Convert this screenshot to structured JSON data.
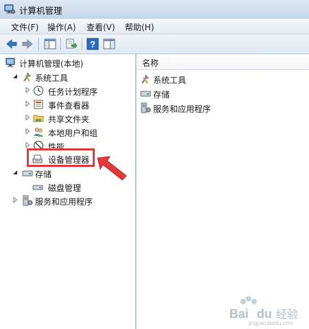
{
  "window": {
    "title": "计算机管理"
  },
  "menu": [
    "文件(F)",
    "操作(A)",
    "查看(V)",
    "帮助(H)"
  ],
  "toolbar": {
    "buttons": [
      "back-icon",
      "forward-icon",
      "show-hide-console-tree-icon",
      "export-list-icon",
      "help-icon",
      "show-hide-action-pane-icon"
    ]
  },
  "tree": {
    "root": "计算机管理(本地)",
    "system_tools": "系统工具",
    "task_scheduler": "任务计划程序",
    "event_viewer": "事件查看器",
    "shared_folders": "共享文件夹",
    "local_users": "本地用户和组",
    "performance": "性能",
    "device_manager": "设备管理器",
    "storage": "存储",
    "disk_management": "磁盘管理",
    "services_apps": "服务和应用程序"
  },
  "list": {
    "column_name": "名称",
    "items": [
      "系统工具",
      "存储",
      "服务和应用程序"
    ]
  },
  "annotation": {
    "highlight_color": "#e03a3a",
    "highlighted_item": "设备管理器"
  },
  "watermark": {
    "text": "Baidu 经验",
    "sub": "jingyan.baidu.com"
  }
}
